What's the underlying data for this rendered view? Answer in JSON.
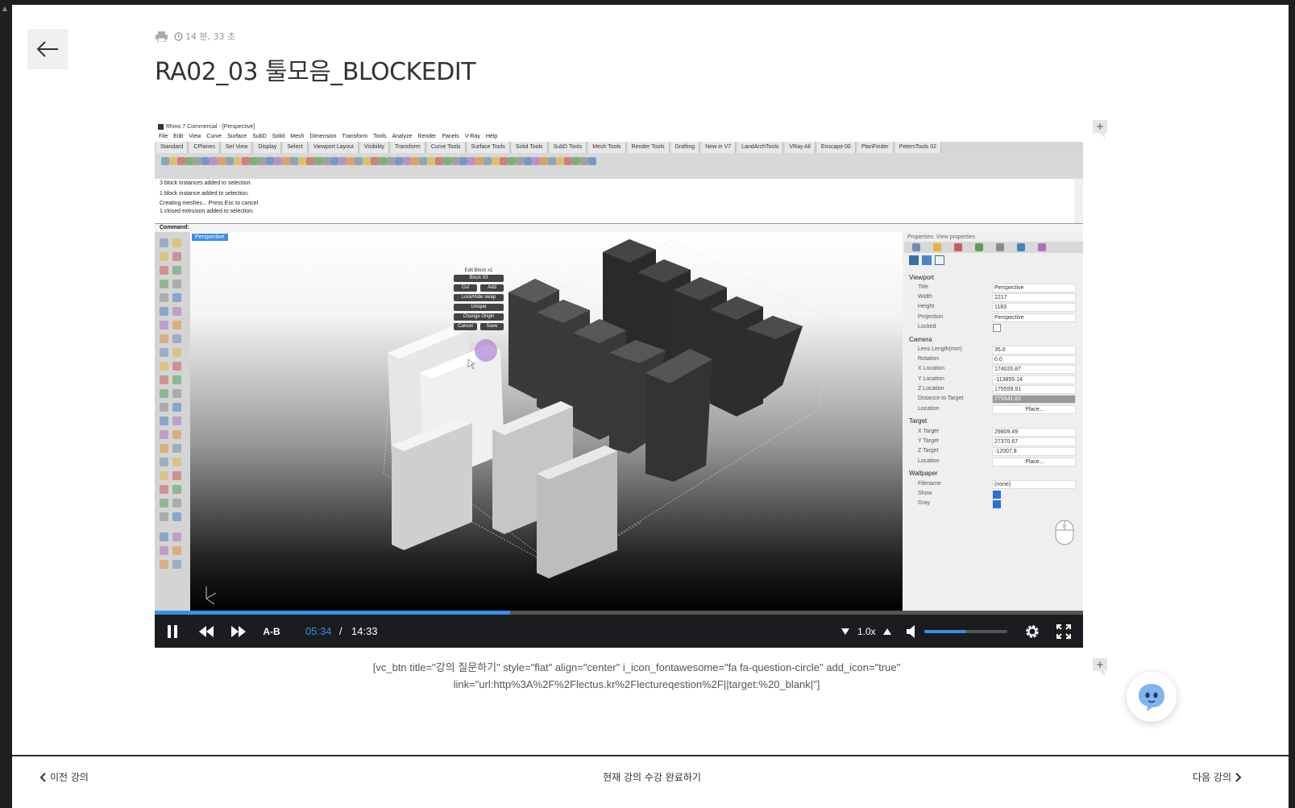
{
  "header": {
    "duration": "14 분, 33 초",
    "title": "RA02_03 툴모음_BLOCKEDIT",
    "print_icon": "printer-icon",
    "clock_icon": "clock-icon",
    "back_icon": "arrow-left-icon"
  },
  "rhino": {
    "window_title": "Rhino 7 Commercial - [Perspective]",
    "menu": [
      "File",
      "Edit",
      "View",
      "Curve",
      "Surface",
      "SubD",
      "Solid",
      "Mesh",
      "Dimension",
      "Transform",
      "Tools",
      "Analyze",
      "Render",
      "Panels",
      "V-Ray",
      "Help"
    ],
    "tabs": [
      "Standard",
      "CPlanes",
      "Set View",
      "Display",
      "Select",
      "Viewport Layout",
      "Visibility",
      "Transform",
      "Curve Tools",
      "Surface Tools",
      "Solid Tools",
      "SubD Tools",
      "Mesh Tools",
      "Render Tools",
      "Drafting",
      "New in V7",
      "LandArchTools",
      "VRay All",
      "Enscape 00",
      "PlanFinder",
      "PetersTools 02"
    ],
    "history": [
      "3 block instances added to selection.",
      "1 block instance added to selection.",
      "Creating meshes... Press Esc to cancel",
      "1 closed extrusion added to selection."
    ],
    "command": "Command:",
    "viewport_label": "Perspective",
    "block_menu": {
      "title": "Edit Block x1",
      "name": "Block 03",
      "cut": "Cut",
      "add": "Add",
      "lock": "Lock/Hide swap",
      "unique": "Unique",
      "change_origin": "Change Origin",
      "cancel": "Cancel",
      "save": "Save"
    },
    "props": {
      "header": "Properties: View properties",
      "viewport_section": "Viewport",
      "viewport": [
        {
          "label": "Title",
          "value": "Perspective"
        },
        {
          "label": "Width",
          "value": "2217"
        },
        {
          "label": "Height",
          "value": "1183"
        },
        {
          "label": "Projection",
          "value": "Perspective"
        }
      ],
      "locked_label": "Locked",
      "camera_section": "Camera",
      "camera": [
        {
          "label": "Lens Length(mm)",
          "value": "35.0"
        },
        {
          "label": "Rotation",
          "value": "0.0"
        },
        {
          "label": "X Location",
          "value": "174020.87"
        },
        {
          "label": "Y Location",
          "value": "-113855.14"
        },
        {
          "label": "Z Location",
          "value": "175559.91"
        },
        {
          "label": "Distance to Target",
          "value": "275541.82"
        },
        {
          "label": "Location",
          "value": "Place..."
        }
      ],
      "target_section": "Target",
      "target": [
        {
          "label": "X Target",
          "value": "29809.49"
        },
        {
          "label": "Y Target",
          "value": "27370.67"
        },
        {
          "label": "Z Target",
          "value": "-12007.8"
        },
        {
          "label": "Location",
          "value": "Place..."
        }
      ],
      "wallpaper_section": "Wallpaper",
      "filename_label": "Filename",
      "filename_value": "(none)",
      "show_label": "Show",
      "gray_label": "Gray"
    }
  },
  "player": {
    "ab_label": "A-B",
    "current_time": "05:34",
    "separator": "/",
    "total_time": "14:33",
    "speed": "1.0x",
    "progress": 0.383,
    "volume": 0.5,
    "accent": "#3a8ee6"
  },
  "shortcode": {
    "line1": "[vc_btn title=\"강의 질문하기\" style=\"flat\" align=\"center\" i_icon_fontawesome=\"fa fa-question-circle\" add_icon=\"true\"",
    "line2": "link=\"url:http%3A%2F%2Flectus.kr%2Flectureqestion%2F||target:%20_blank|\"]"
  },
  "footer": {
    "prev": "이전 강의",
    "complete": "현재 강의 수강 완료하기",
    "next": "다음 강의"
  }
}
